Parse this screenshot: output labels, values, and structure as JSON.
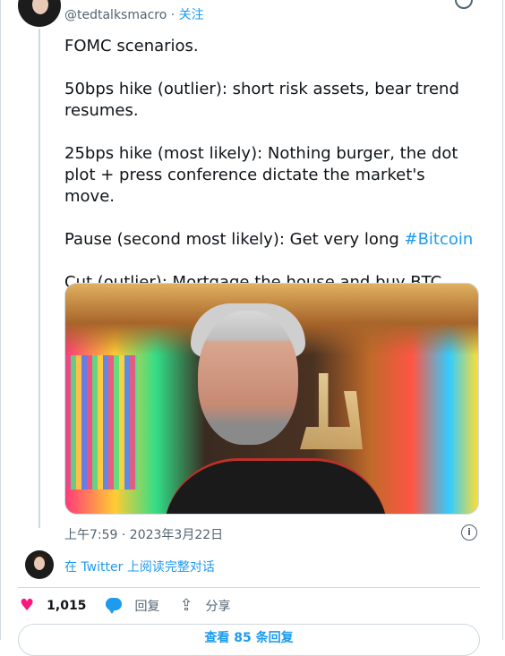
{
  "author": {
    "handle": "@tedtalksmacro",
    "separator": " · ",
    "follow_label": "关注"
  },
  "tweet": {
    "paragraphs": [
      "FOMC scenarios.",
      "50bps hike (outlier): short risk assets, bear trend resumes.",
      "25bps hike (most likely): Nothing burger, the dot plot + press conference dictate the market's move."
    ],
    "pause_text": "Pause (second most likely): Get very long ",
    "hashtag": "#Bitcoin",
    "cut_text": "Cut (outlier): Mortgage the house and buy BTC",
    "timestamp": "上午7:59 · 2023年3月22日"
  },
  "thread": {
    "read_label": "在 Twitter 上阅读完整对话"
  },
  "actions": {
    "likes": "1,015",
    "reply_label": "回复",
    "share_label": "分享"
  },
  "footer": {
    "more_replies_label": "查看 85 条回复"
  },
  "icons": {
    "info": "info-icon",
    "like": "heart-icon",
    "reply": "reply-bubble-icon",
    "share": "share-icon"
  },
  "colors": {
    "accent": "#1d9bf0",
    "like": "#f91880",
    "text": "#0f1419",
    "muted": "#536471",
    "border": "#cfd9de"
  }
}
